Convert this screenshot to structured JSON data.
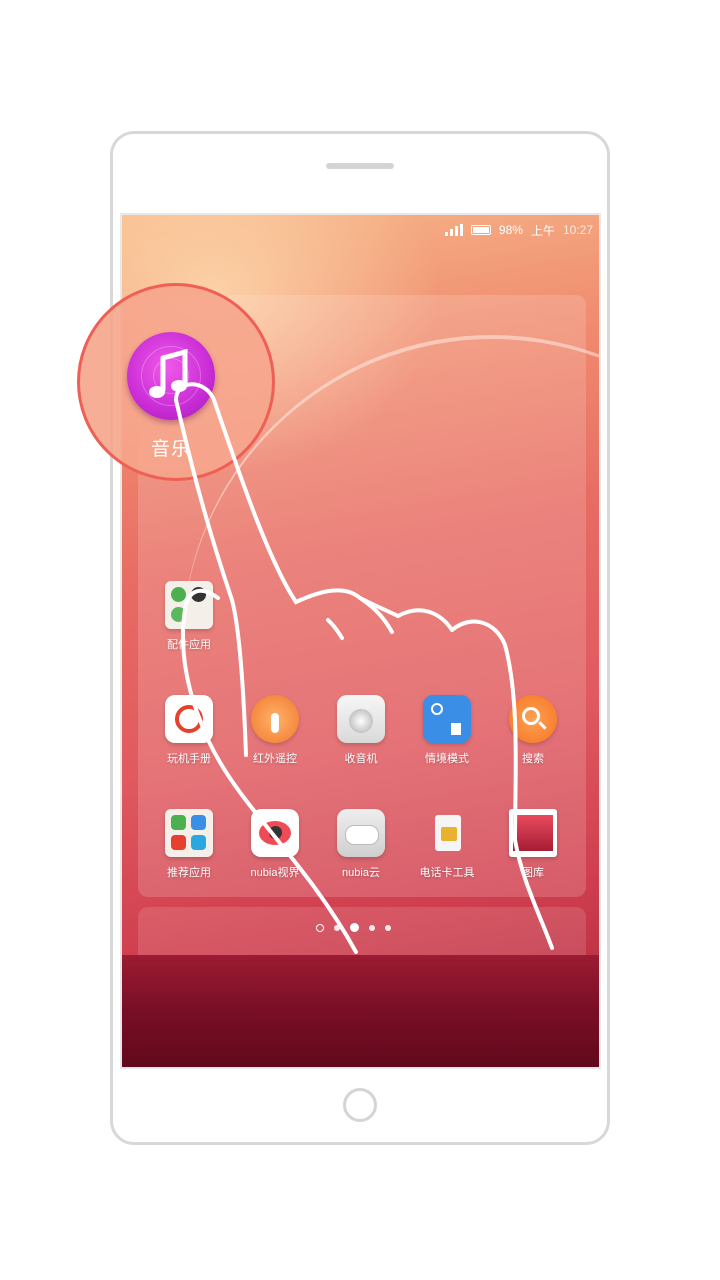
{
  "statusbar": {
    "battery": "98%",
    "ampm": "上午",
    "time": "10:27"
  },
  "highlight_app": {
    "label": "音乐",
    "icon": "music-note-icon",
    "color": "#c92cd6"
  },
  "folder_apps": [
    {
      "label": "配件应用",
      "icon": "folder-icon"
    }
  ],
  "row1": [
    {
      "label": "玩机手册",
      "icon": "manual-icon"
    },
    {
      "label": "红外遥控",
      "icon": "infrared-remote-icon"
    },
    {
      "label": "收音机",
      "icon": "radio-icon"
    },
    {
      "label": "情境模式",
      "icon": "scene-mode-icon"
    },
    {
      "label": "搜索",
      "icon": "search-icon"
    }
  ],
  "row2": [
    {
      "label": "推荐应用",
      "icon": "folder-icon"
    },
    {
      "label": "nubia视界",
      "icon": "camera-eye-icon"
    },
    {
      "label": "nubia云",
      "icon": "cloud-icon"
    },
    {
      "label": "电话卡工具",
      "icon": "sim-card-icon"
    },
    {
      "label": "图库",
      "icon": "gallery-icon"
    }
  ],
  "page_indicator": {
    "pages": 5,
    "active": 2
  },
  "colors": {
    "wallpaper_top": "#f6b78a",
    "wallpaper_bottom": "#a8263a",
    "highlight_ring": "#ef5f55"
  }
}
